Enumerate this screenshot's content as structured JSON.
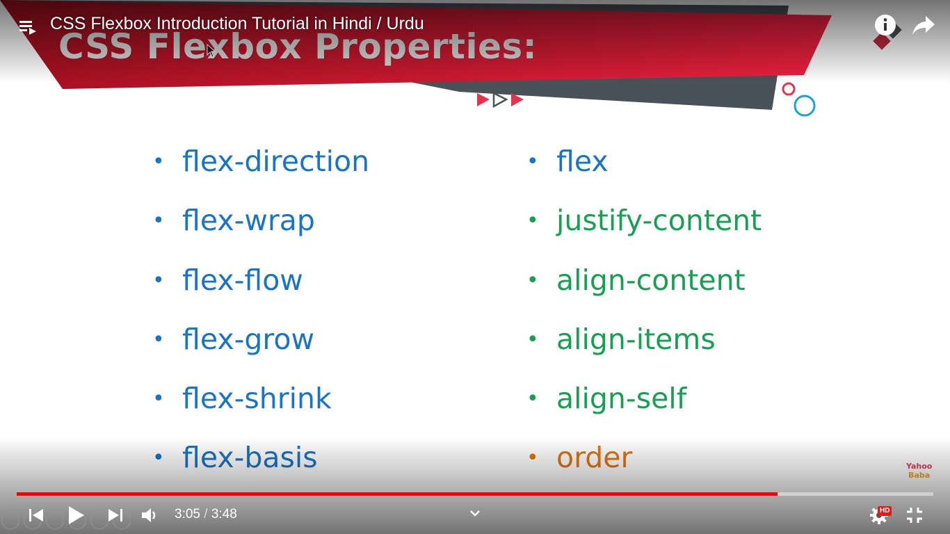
{
  "video": {
    "title": "CSS Flexbox Introduction Tutorial in Hindi / Urdu",
    "current_time": "3:05",
    "time_separator": "/",
    "duration": "3:48",
    "progress_fraction": 0.8304,
    "quality_badge": "HD"
  },
  "slide": {
    "title": "CSS Flexbox Properties:",
    "left_column": [
      {
        "text": "flex-direction",
        "color": "#1874c6"
      },
      {
        "text": "flex-wrap",
        "color": "#1874c6"
      },
      {
        "text": "flex-flow",
        "color": "#1874c6"
      },
      {
        "text": "flex-grow",
        "color": "#1874c6"
      },
      {
        "text": "flex-shrink",
        "color": "#1874c6"
      },
      {
        "text": "flex-basis",
        "color": "#1874c6"
      }
    ],
    "right_column": [
      {
        "text": "flex",
        "color": "#1874c6"
      },
      {
        "text": "justify-content",
        "color": "#15a052"
      },
      {
        "text": "align-content",
        "color": "#15a052"
      },
      {
        "text": "align-items",
        "color": "#15a052"
      },
      {
        "text": "align-self",
        "color": "#15a052"
      },
      {
        "text": "order",
        "color": "#e27410"
      }
    ],
    "bullet": "•",
    "watermark": {
      "line1": "Yahoo",
      "line2": "Baba"
    }
  },
  "colors": {
    "banner_red": "#e31e3a",
    "banner_dark": "#4a5259",
    "progress_played": "#ff0000"
  },
  "icons": {
    "playlist": "playlist-icon",
    "info": "info-icon",
    "share": "share-icon",
    "previous": "skip-previous-icon",
    "play": "play-icon",
    "next": "skip-next-icon",
    "volume": "volume-icon",
    "chevron": "chevron-down-icon",
    "settings": "gear-icon",
    "fullscreen_exit": "exit-fullscreen-icon"
  }
}
